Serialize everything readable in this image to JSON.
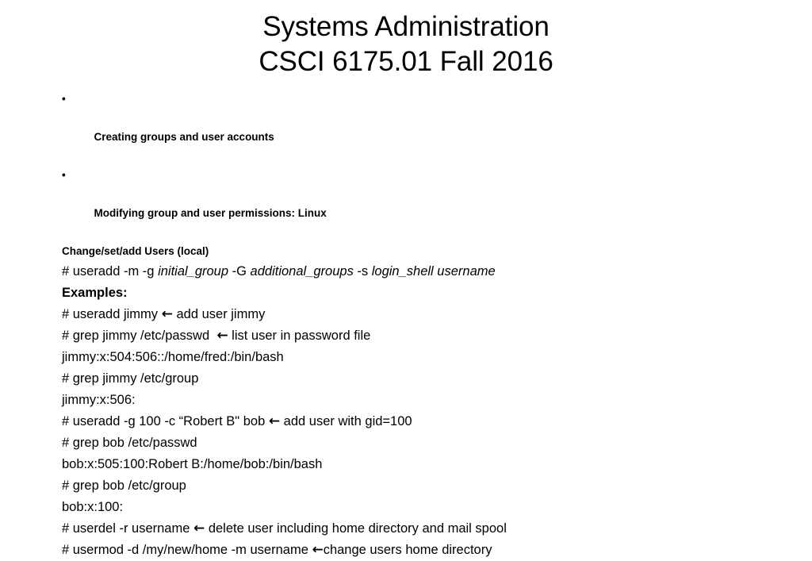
{
  "slide": {
    "background_color": "#ffffff",
    "text_color": "#000000",
    "title": {
      "line1": "Systems Administration",
      "line2": "CSCI 6175.01 Fall 2016"
    },
    "bullets": [
      {
        "marker": "•",
        "text": "Creating groups and user accounts"
      },
      {
        "marker": "•",
        "text": "Modifying group and user permissions: Linux"
      }
    ],
    "subheading": "Change/set/add Users (local)",
    "syntax_line": {
      "part1": "# useradd -m -g ",
      "italic1": "initial_group",
      "part2": " -G ",
      "italic2": "additional_groups",
      "part3": " -s ",
      "italic3": "login_shell username"
    },
    "examples_label": "Examples:",
    "lines": [
      {
        "command": "# useradd jimmy ",
        "arrow": "←",
        "comment": " add user jimmy"
      },
      {
        "command": "# grep jimmy /etc/passwd  ",
        "arrow": "←",
        "comment": " list user in password file"
      },
      {
        "command": "jimmy:x:504:506::/home/fred:/bin/bash",
        "arrow": "",
        "comment": ""
      },
      {
        "command": "# grep jimmy /etc/group",
        "arrow": "",
        "comment": ""
      },
      {
        "command": "jimmy:x:506:",
        "arrow": "",
        "comment": ""
      },
      {
        "command": "# useradd -g 100 -c “Robert B\" bob ",
        "arrow": "←",
        "comment": " add user with gid=100"
      },
      {
        "command": "# grep bob /etc/passwd",
        "arrow": "",
        "comment": ""
      },
      {
        "command": "bob:x:505:100:Robert B:/home/bob:/bin/bash",
        "arrow": "",
        "comment": ""
      },
      {
        "command": "# grep bob /etc/group",
        "arrow": "",
        "comment": ""
      },
      {
        "command": "bob:x:100:",
        "arrow": "",
        "comment": ""
      },
      {
        "command": "# userdel -r username ",
        "arrow": "←",
        "comment": " delete user including home directory and mail spool"
      },
      {
        "command": "# usermod -d /my/new/home -m username ",
        "arrow": "←",
        "comment": "change users home directory"
      }
    ]
  }
}
